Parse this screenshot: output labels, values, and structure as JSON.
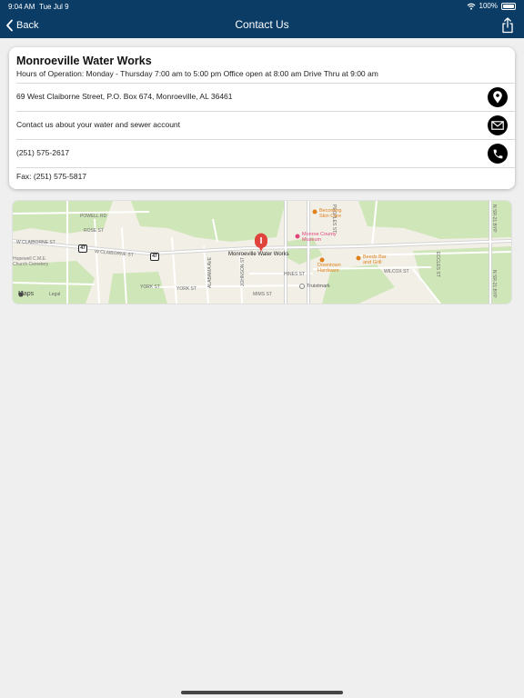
{
  "status_bar": {
    "time": "9:04 AM",
    "date": "Tue Jul 9",
    "battery": "100%"
  },
  "nav": {
    "back_label": "Back",
    "title": "Contact Us"
  },
  "contact": {
    "name": "Monroeville Water Works",
    "hours": "Hours of Operation: Monday - Thursday 7:00 am to 5:00 pm  Office open at 8:00 am  Drive Thru at 9:00 am",
    "address": "69 West Claiborne Street, P.O. Box 674, Monroeville, AL 36461",
    "email_text": "Contact us about your water and sewer account",
    "phone": "(251) 575-2617",
    "fax": "Fax: (251) 575-5817"
  },
  "map": {
    "pin_label": "Monroeville Water Works",
    "logo": "Maps",
    "legal": "Legal",
    "highway": "47",
    "streets": [
      "POWELL RD",
      "ROSE ST",
      "W CLAIBORNE ST",
      "W CLAIBORNE ST",
      "YORK ST",
      "YORK ST",
      "HINES ST",
      "JOHNSON ST",
      "ALABAMA AVE",
      "MIMS ST",
      "WILCOX ST",
      "N SR-21 BYP",
      "N SR-21 BYP",
      "ECCLES ST",
      "PEOPLES ST"
    ],
    "pois": [
      "Becoming Skin Care",
      "Monroe County Museum",
      "Downtown Hardware",
      "Beeds Bar and Grill",
      "Truistmark",
      "Hopewell C.M.E. Church Cemetery"
    ]
  },
  "colors": {
    "nav_bg": "#0b3c66",
    "map_green": "#cfe6b8",
    "pin_red": "#e0433b",
    "poi_orange": "#e0801c",
    "poi_pink": "#e0457b"
  }
}
